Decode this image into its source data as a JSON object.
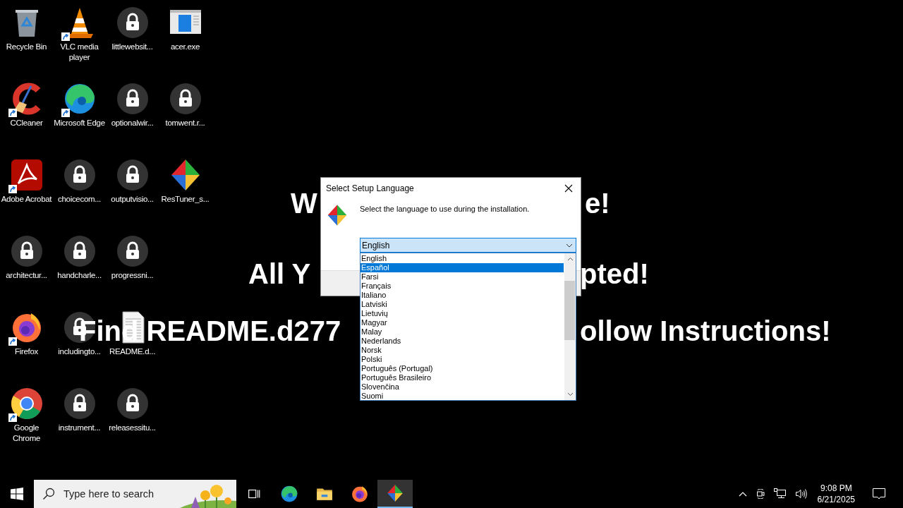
{
  "desktop": {
    "icon_rows": [
      [
        {
          "label": "Recycle Bin",
          "kind": "recycle",
          "shortcut": false
        },
        {
          "label": "VLC media player",
          "kind": "vlc",
          "shortcut": true
        },
        {
          "label": "littlewebsit...",
          "kind": "lock",
          "shortcut": false
        },
        {
          "label": "acer.exe",
          "kind": "acer",
          "shortcut": false
        }
      ],
      [
        {
          "label": "CCleaner",
          "kind": "ccleaner",
          "shortcut": true
        },
        {
          "label": "Microsoft Edge",
          "kind": "edge",
          "shortcut": true
        },
        {
          "label": "optionalwir...",
          "kind": "lock",
          "shortcut": false
        },
        {
          "label": "tomwent.r...",
          "kind": "lock",
          "shortcut": false
        }
      ],
      [
        {
          "label": "Adobe Acrobat",
          "kind": "acrobat",
          "shortcut": true
        },
        {
          "label": "choicecom...",
          "kind": "lock",
          "shortcut": false
        },
        {
          "label": "outputvisio...",
          "kind": "lock",
          "shortcut": false
        },
        {
          "label": "ResTuner_s...",
          "kind": "restuner",
          "shortcut": false
        }
      ],
      [
        {
          "label": "architectur...",
          "kind": "lock",
          "shortcut": false
        },
        {
          "label": "handcharle...",
          "kind": "lock",
          "shortcut": false
        },
        {
          "label": "progressni...",
          "kind": "lock",
          "shortcut": false
        }
      ],
      [
        {
          "label": "Firefox",
          "kind": "firefox",
          "shortcut": true
        },
        {
          "label": "includingto...",
          "kind": "lock",
          "shortcut": false
        },
        {
          "label": "README.d...",
          "kind": "document",
          "shortcut": false
        }
      ],
      [
        {
          "label": "Google Chrome",
          "kind": "chrome",
          "shortcut": true
        },
        {
          "label": "instrument...",
          "kind": "lock",
          "shortcut": false
        },
        {
          "label": "releasessitu...",
          "kind": "lock",
          "shortcut": false
        }
      ]
    ],
    "wallpaper_lines": [
      {
        "left": "W",
        "right": "e!"
      },
      {
        "left": "All Y",
        "right": "pted!"
      },
      {
        "left": "Find README.d277",
        "right": "ollow Instructions!"
      }
    ]
  },
  "dialog": {
    "title": "Select Setup Language",
    "message": "Select the language to use during the installation.",
    "combobox": {
      "value": "English",
      "expanded": true
    },
    "options": [
      {
        "label": "English",
        "selected": false
      },
      {
        "label": "Español",
        "selected": true
      },
      {
        "label": "Farsi",
        "selected": false
      },
      {
        "label": "Français",
        "selected": false
      },
      {
        "label": "Italiano",
        "selected": false
      },
      {
        "label": "Latviski",
        "selected": false
      },
      {
        "label": "Lietuvių",
        "selected": false
      },
      {
        "label": "Magyar",
        "selected": false
      },
      {
        "label": "Malay",
        "selected": false
      },
      {
        "label": "Nederlands",
        "selected": false
      },
      {
        "label": "Norsk",
        "selected": false
      },
      {
        "label": "Polski",
        "selected": false
      },
      {
        "label": "Português (Portugal)",
        "selected": false
      },
      {
        "label": "Português Brasileiro",
        "selected": false
      },
      {
        "label": "Slovenčina",
        "selected": false
      },
      {
        "label": "Suomi",
        "selected": false
      }
    ]
  },
  "taskbar": {
    "search": {
      "placeholder": "Type here to search"
    },
    "apps": [
      {
        "kind": "taskview",
        "active": false
      },
      {
        "kind": "edge",
        "active": false
      },
      {
        "kind": "explorer",
        "active": false
      },
      {
        "kind": "firefox",
        "active": false
      },
      {
        "kind": "restuner",
        "active": true
      }
    ],
    "clock": {
      "time": "9:08 PM",
      "date": "6/21/2025"
    }
  }
}
